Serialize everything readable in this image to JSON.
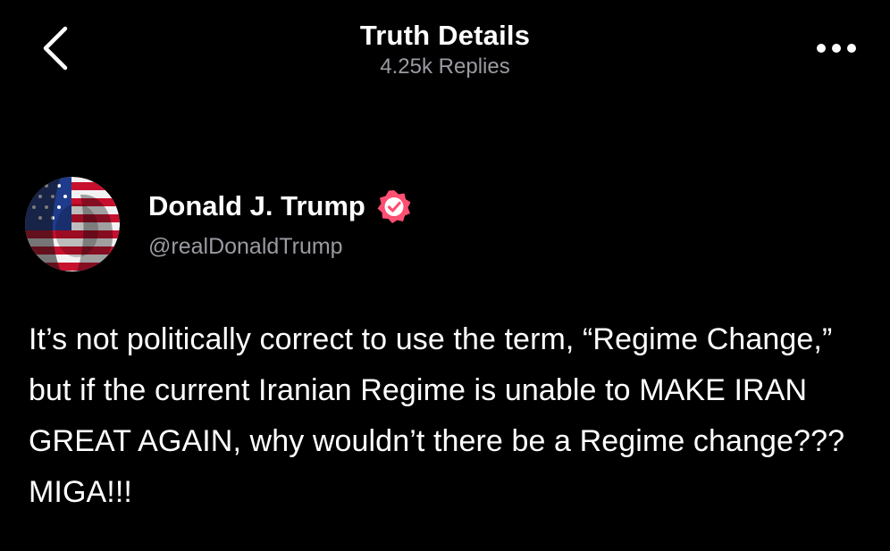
{
  "header": {
    "title": "Truth Details",
    "subtitle": "4.25k Replies",
    "back_icon": "chevron-left-icon",
    "more_icon": "more-horizontal-icon"
  },
  "post": {
    "author": {
      "display_name": "Donald J. Trump",
      "handle": "@realDonaldTrump",
      "verified": true,
      "verified_badge_color": "#ff4f72"
    },
    "text": "It’s not politically correct to use the term, “Regime Change,” but if the current Iranian Regime is unable to MAKE IRAN GREAT AGAIN, why wouldn’t there be a Regime change??? MIGA!!!"
  },
  "colors": {
    "background": "#000000",
    "primary_text": "#ffffff",
    "secondary_text": "#9a9aa2",
    "accent": "#ff4f72"
  }
}
